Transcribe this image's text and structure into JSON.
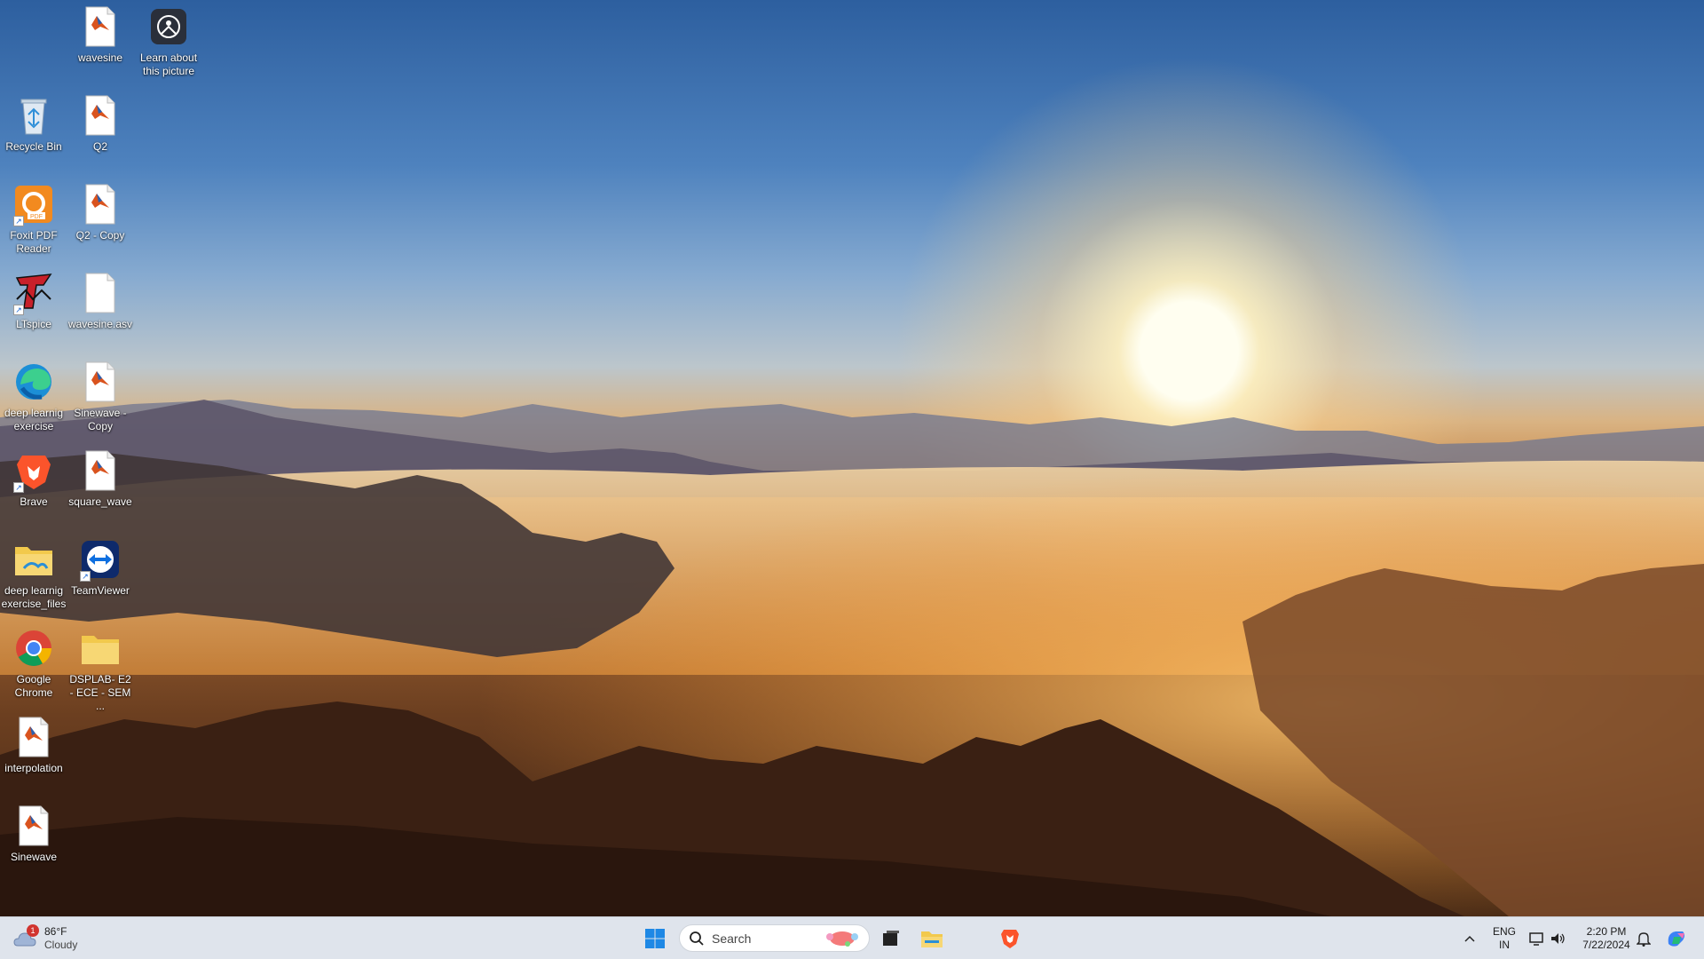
{
  "desktop": {
    "icons": [
      {
        "name": "wavesine",
        "label": "wavesine",
        "type": "matlab-file-icon"
      },
      {
        "name": "learn-about-picture",
        "label": "Learn about this picture",
        "type": "camera-info-icon"
      },
      {
        "name": "recycle-bin",
        "label": "Recycle Bin",
        "type": "recycle-bin-icon"
      },
      {
        "name": "q2",
        "label": "Q2",
        "type": "matlab-file-icon"
      },
      {
        "name": "foxit-pdf-reader",
        "label": "Foxit PDF Reader",
        "type": "foxit-pdf-icon"
      },
      {
        "name": "q2-copy",
        "label": "Q2 - Copy",
        "type": "matlab-file-icon"
      },
      {
        "name": "ltspice",
        "label": "LTspice",
        "type": "ltspice-icon"
      },
      {
        "name": "wavesine-asv",
        "label": "wavesine.asv",
        "type": "blank-file-icon"
      },
      {
        "name": "deep-learnig-exercise",
        "label": "deep learnig exercise",
        "type": "edge-icon"
      },
      {
        "name": "sinewave-copy",
        "label": "Sinewave - Copy",
        "type": "matlab-file-icon"
      },
      {
        "name": "brave",
        "label": "Brave",
        "type": "brave-icon"
      },
      {
        "name": "square-wave",
        "label": "square_wave",
        "type": "matlab-file-icon"
      },
      {
        "name": "deep-learnig-exercise-files",
        "label": "deep learnig exercise_files",
        "type": "folder-icon"
      },
      {
        "name": "teamviewer",
        "label": "TeamViewer",
        "type": "teamviewer-icon"
      },
      {
        "name": "google-chrome",
        "label": "Google Chrome",
        "type": "chrome-icon"
      },
      {
        "name": "dsplab-folder",
        "label": "DSPLAB- E2 - ECE - SEM ...",
        "type": "folder-icon"
      },
      {
        "name": "interpolation",
        "label": "interpolation",
        "type": "matlab-file-icon"
      },
      {
        "name": "sinewave",
        "label": "Sinewave",
        "type": "matlab-file-icon"
      }
    ]
  },
  "taskbar": {
    "weather": {
      "temp": "86°F",
      "condition": "Cloudy",
      "badge": "1"
    },
    "search_placeholder": "Search",
    "language": {
      "line1": "ENG",
      "line2": "IN"
    },
    "clock": {
      "time": "2:20 PM",
      "date": "7/22/2024"
    }
  },
  "colors": {
    "taskbar": "#dfe4ec",
    "accent": "#0078d4"
  }
}
